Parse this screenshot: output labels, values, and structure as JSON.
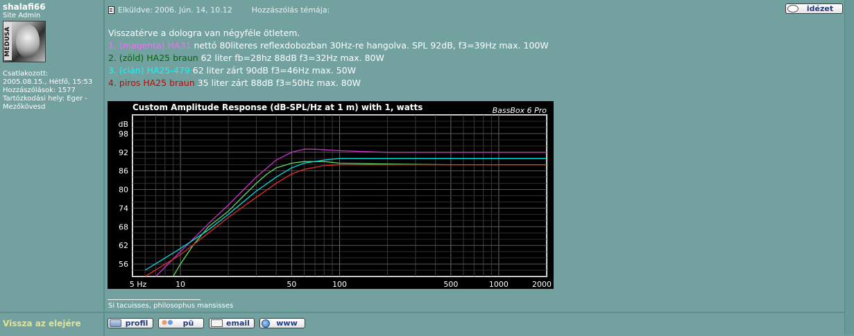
{
  "author": {
    "name": "shalafi66",
    "rank": "Site Admin",
    "avatar_text": "MEDUSA",
    "joined_label": "Csatlakozott:",
    "joined_date": "2005.08.15., Hétfő, 15:53",
    "posts_label": "Hozzászólások:",
    "posts": "1577",
    "location_label": "Tartózkodási hely:",
    "location": "Eger - Mezőkövesd"
  },
  "post": {
    "posted_label": "Elküldve:",
    "posted_date": "2006. Jún. 14, 10.12",
    "subject_label": "Hozzászólás témája:",
    "quote_button": "idézet",
    "intro": "Visszatérve a dologra van négyféle ötletem.",
    "items": [
      {
        "num": "1.",
        "tag": "(magenta) HA31",
        "text": "nettó 80literes reflexdobozban 30Hz-re hangolva. SPL 92dB, f3=39Hz max. 100W",
        "color": "#ff66ff"
      },
      {
        "num": "2.",
        "tag": "(zöld) HA25 braun",
        "text": "62 liter fb=28hz 88dB f3=32Hz max. 80W",
        "color": "#006600"
      },
      {
        "num": "3.",
        "tag": "(cián) HA25-479",
        "text": "62 liter zárt 90dB f3=46Hz max. 50W",
        "color": "#00ffff"
      },
      {
        "num": "4.",
        "tag": "piros HA25 braun",
        "text": "35 liter zárt 88dB f3=50Hz max. 80W",
        "color": "#cc0000"
      }
    ],
    "signature": "Si tacuisses, philosophus mansisses"
  },
  "footer": {
    "back_to_top": "Vissza az elejére",
    "buttons": {
      "profile": "profil",
      "pm": "pü",
      "email": "email",
      "www": "www"
    }
  },
  "chart_data": {
    "type": "line",
    "title": "Custom Amplitude Response (dB-SPL/Hz at 1 m) with 1, watts",
    "brand": "BassBox 6 Pro",
    "ylabel": "dB",
    "x_scale": "log",
    "xlim": [
      5,
      2000
    ],
    "ylim": [
      52,
      104
    ],
    "x_ticks": [
      5,
      10,
      50,
      100,
      500,
      1000,
      2000
    ],
    "x_tick_labels": [
      "5 Hz",
      "10",
      "50",
      "100",
      "500",
      "1000",
      "2000"
    ],
    "y_ticks": [
      56,
      62,
      68,
      74,
      80,
      86,
      92,
      98
    ],
    "grid": true,
    "series": [
      {
        "name": "HA31",
        "color": "#cc33cc",
        "x": [
          7,
          10,
          15,
          20,
          25,
          30,
          35,
          40,
          50,
          60,
          70,
          100,
          200,
          500,
          1000,
          2000
        ],
        "y": [
          52,
          60,
          69,
          75,
          80,
          84,
          87,
          89.5,
          92,
          93,
          93,
          92.5,
          92,
          92,
          92,
          92
        ]
      },
      {
        "name": "HA25 braun (62 l)",
        "color": "#66dd66",
        "x": [
          9,
          10,
          12,
          15,
          20,
          25,
          30,
          35,
          40,
          50,
          60,
          80,
          100,
          200,
          500,
          1000,
          2000
        ],
        "y": [
          52,
          56,
          62,
          68,
          73,
          78,
          82,
          85,
          87,
          88.5,
          89,
          89,
          88.5,
          88.2,
          88,
          88,
          88
        ]
      },
      {
        "name": "HA25-479",
        "color": "#00e0e0",
        "x": [
          6,
          10,
          15,
          20,
          30,
          40,
          50,
          60,
          80,
          100,
          200,
          500,
          1000,
          2000
        ],
        "y": [
          54,
          61,
          67,
          72,
          79.5,
          84,
          87,
          88.5,
          89.5,
          90,
          90,
          90,
          90,
          90
        ]
      },
      {
        "name": "HA25 braun (35 l)",
        "color": "#e03030",
        "x": [
          6,
          10,
          15,
          20,
          30,
          40,
          50,
          60,
          80,
          100,
          200,
          500,
          1000,
          2000
        ],
        "y": [
          52,
          59,
          66,
          71,
          77.5,
          82,
          85,
          86.5,
          87.7,
          88,
          88,
          88,
          88,
          88
        ]
      }
    ]
  }
}
